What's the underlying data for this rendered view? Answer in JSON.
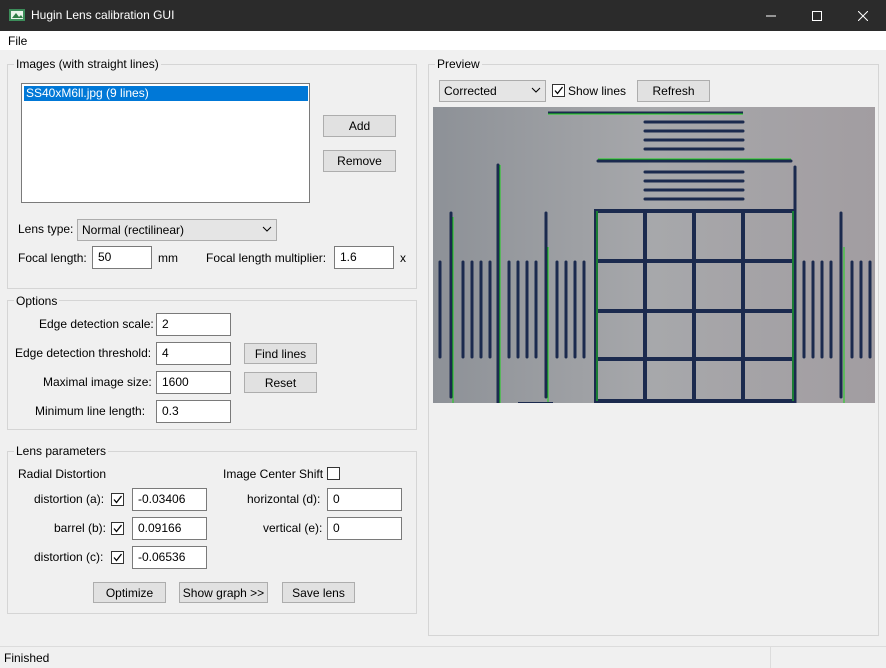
{
  "window": {
    "title": "Hugin Lens calibration GUI"
  },
  "menu": {
    "file": "File"
  },
  "images": {
    "legend": "Images (with straight lines)",
    "list": [
      "SS40xM6ll.jpg (9 lines)"
    ],
    "add": "Add",
    "remove": "Remove",
    "lens_type_label": "Lens type:",
    "lens_type_value": "Normal (rectilinear)",
    "focal_length_label": "Focal length:",
    "focal_length_value": "50",
    "focal_length_unit": "mm",
    "multiplier_label": "Focal length multiplier:",
    "multiplier_value": "1.6",
    "multiplier_unit": "x"
  },
  "options": {
    "legend": "Options",
    "edge_scale_label": "Edge detection scale:",
    "edge_scale_value": "2",
    "edge_threshold_label": "Edge detection threshold:",
    "edge_threshold_value": "4",
    "max_size_label": "Maximal image size:",
    "max_size_value": "1600",
    "min_line_label": "Minimum line length:",
    "min_line_value": "0.3",
    "find_lines": "Find lines",
    "reset": "Reset"
  },
  "lens": {
    "legend": "Lens parameters",
    "radial_label": "Radial Distortion",
    "center_shift_label": "Image Center Shift",
    "a_label": "distortion (a):",
    "a_value": "-0.03406",
    "b_label": "barrel (b):",
    "b_value": "0.09166",
    "c_label": "distortion (c):",
    "c_value": "-0.06536",
    "d_label": "horizontal (d):",
    "d_value": "0",
    "e_label": "vertical (e):",
    "e_value": "0",
    "optimize": "Optimize",
    "show_graph": "Show graph >>",
    "save_lens": "Save lens"
  },
  "preview": {
    "legend": "Preview",
    "mode_value": "Corrected",
    "show_lines_label": "Show lines",
    "refresh": "Refresh"
  },
  "status": {
    "text": "Finished"
  }
}
